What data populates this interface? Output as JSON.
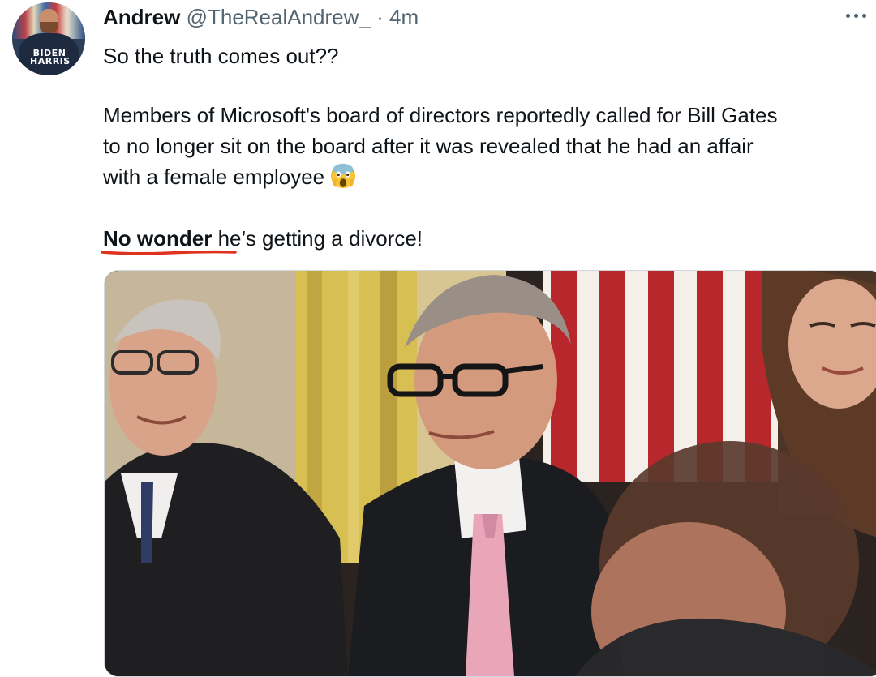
{
  "tweet": {
    "author": {
      "display_name": "Andrew",
      "handle": "@TheRealAndrew_",
      "separator": "·",
      "time_ago": "4m",
      "avatar_text": "BIDEN HARRIS"
    },
    "body": {
      "line1": "So the truth comes out??",
      "line2": "Members of Microsoft's board of directors reportedly called for Bill Gates",
      "line3": "to no longer sit on the board after it was revealed that he had an affair",
      "line4": "with a female employee",
      "line4_emoji": "screaming-face-emoji",
      "line5_bold": "No wonder",
      "line5_rest": " he’s getting a divorce!"
    },
    "media": {
      "type": "photo"
    },
    "colors": {
      "annotation_underline": "#e0331f",
      "secondary_text": "#536471"
    }
  }
}
